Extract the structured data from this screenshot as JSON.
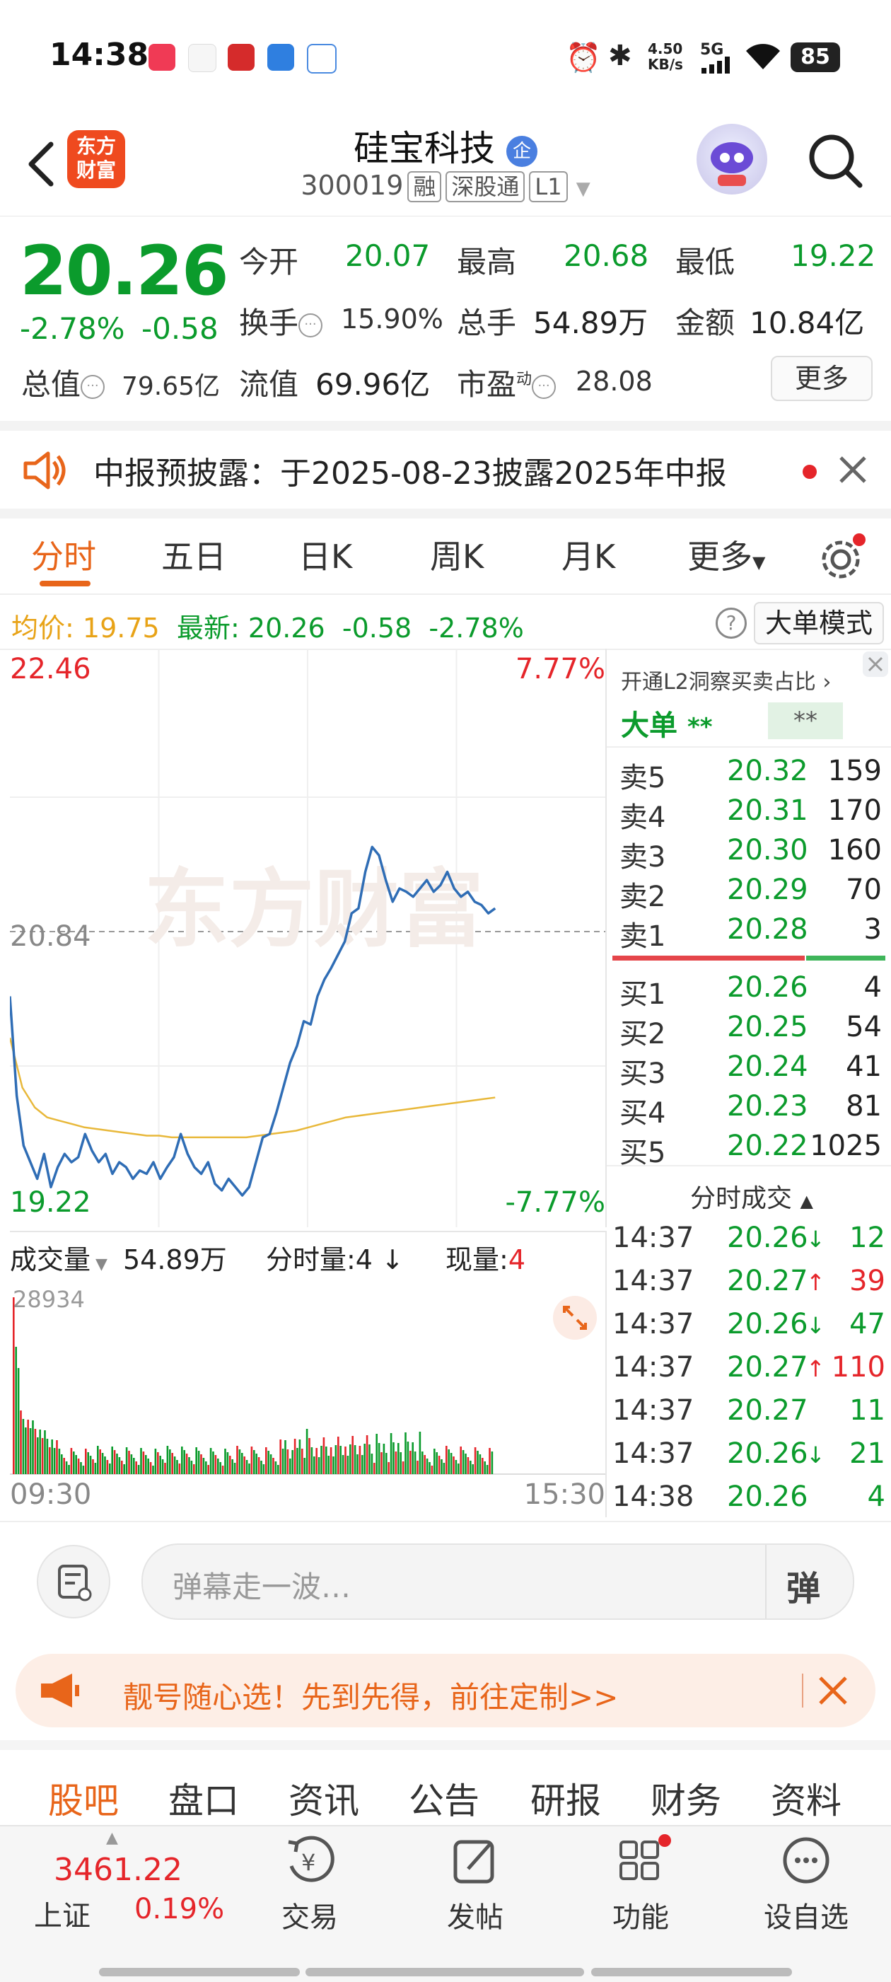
{
  "status_bar": {
    "time": "14:38",
    "net_speed_top": "4.50",
    "net_speed_bottom": "KB/s",
    "signal_label": "5G",
    "battery": "85"
  },
  "header": {
    "stock_name": "硅宝科技",
    "enterprise_badge": "企",
    "stock_code": "300019",
    "tags": [
      "融",
      "深股通",
      "L1"
    ]
  },
  "quote": {
    "price": "20.26",
    "change_pct": "-2.78%",
    "change": "-0.58",
    "open_label": "今开",
    "open": "20.07",
    "high_label": "最高",
    "high": "20.68",
    "low_label": "最低",
    "low": "19.22",
    "turnover_label": "换手",
    "turnover": "15.90%",
    "volume_label": "总手",
    "volume": "54.89万",
    "amount_label": "金额",
    "amount": "10.84亿",
    "mktcap_label": "总值",
    "mktcap": "79.65亿",
    "float_label": "流值",
    "float": "69.96亿",
    "pe_label": "市盈",
    "pe_sup": "动",
    "pe": "28.08",
    "more_label": "更多"
  },
  "notice": {
    "text": "中报预披露：于2025-08-23披露2025年中报"
  },
  "chart_tabs": [
    "分时",
    "五日",
    "日K",
    "周K",
    "月K",
    "更多"
  ],
  "info_line": {
    "avg_label": "均价:",
    "avg": "19.75",
    "latest_label": "最新:",
    "latest": "20.26",
    "change": "-0.58",
    "change_pct": "-2.78%",
    "help": "?",
    "mode_button": "大单模式"
  },
  "chart_labels": {
    "top_price": "22.46",
    "top_pct": "7.77%",
    "mid_price": "20.84",
    "bottom_price": "19.22",
    "bottom_pct": "-7.77%",
    "watermark": "东方财富"
  },
  "volume_labels": {
    "selector": "成交量",
    "total": "54.89万",
    "minute_vol": "分时量:4",
    "cur_label": "现量:",
    "cur": "4",
    "max": "28934",
    "start_time": "09:30",
    "end_time": "15:30"
  },
  "orderbook": {
    "l2_text": "开通L2洞察买卖占比",
    "big_order_label": "大单",
    "big_order_a": "**",
    "big_order_b": "**",
    "asks": [
      {
        "label": "卖5",
        "price": "20.32",
        "qty": "159"
      },
      {
        "label": "卖4",
        "price": "20.31",
        "qty": "170"
      },
      {
        "label": "卖3",
        "price": "20.30",
        "qty": "160"
      },
      {
        "label": "卖2",
        "price": "20.29",
        "qty": "70"
      },
      {
        "label": "卖1",
        "price": "20.28",
        "qty": "3"
      }
    ],
    "bids": [
      {
        "label": "买1",
        "price": "20.26",
        "qty": "4"
      },
      {
        "label": "买2",
        "price": "20.25",
        "qty": "54"
      },
      {
        "label": "买3",
        "price": "20.24",
        "qty": "41"
      },
      {
        "label": "买4",
        "price": "20.23",
        "qty": "81"
      },
      {
        "label": "买5",
        "price": "20.22",
        "qty": "1025"
      }
    ],
    "ticks_title": "分时成交",
    "ticks": [
      {
        "time": "14:37",
        "price": "20.26",
        "dir": "↓",
        "vol": "12"
      },
      {
        "time": "14:37",
        "price": "20.27",
        "dir": "↑",
        "vol": "39"
      },
      {
        "time": "14:37",
        "price": "20.26",
        "dir": "↓",
        "vol": "47"
      },
      {
        "time": "14:37",
        "price": "20.27",
        "dir": "↑",
        "vol": "110"
      },
      {
        "time": "14:37",
        "price": "20.27",
        "dir": "",
        "vol": "11"
      },
      {
        "time": "14:37",
        "price": "20.26",
        "dir": "↓",
        "vol": "21"
      },
      {
        "time": "14:38",
        "price": "20.26",
        "dir": "",
        "vol": "4"
      }
    ]
  },
  "danmu": {
    "placeholder": "弹幕走一波…",
    "send": "弹"
  },
  "promo": {
    "text": "靓号随心选！先到先得，前往定制>>"
  },
  "bottom_tabs": [
    "股吧",
    "盘口",
    "资讯",
    "公告",
    "研报",
    "财务",
    "资料"
  ],
  "nav": {
    "index_value": "3461.22",
    "index_name": "上证",
    "index_pct": "0.19%",
    "items": [
      "交易",
      "发帖",
      "功能",
      "设自选"
    ]
  },
  "chart_data": {
    "type": "line",
    "title": "",
    "xlabel": "",
    "ylabel": "",
    "x_range": [
      "09:30",
      "15:30"
    ],
    "ylim": [
      19.22,
      22.46
    ],
    "reference": 20.84,
    "series": [
      {
        "values": [
          20.45,
          19.85,
          19.55,
          19.45,
          19.35,
          19.5,
          19.3,
          19.42,
          19.5,
          19.45,
          19.48,
          19.62,
          19.52,
          19.45,
          19.5,
          19.38,
          19.45,
          19.42,
          19.35,
          19.4,
          19.38,
          19.45,
          19.35,
          19.42,
          19.48,
          19.62,
          19.5,
          19.42,
          19.38,
          19.45,
          19.32,
          19.28,
          19.35,
          19.3,
          19.25,
          19.3,
          19.45,
          19.6,
          19.62,
          19.75,
          19.9,
          20.05,
          20.15,
          20.3,
          20.28,
          20.45,
          20.55,
          20.62,
          20.7,
          20.78,
          20.95,
          20.98,
          21.2,
          21.35,
          21.3,
          21.15,
          21.02,
          21.1,
          21.08,
          21.05,
          21.1,
          21.15,
          21.08,
          21.12,
          21.2,
          21.1,
          21.05,
          21.08,
          21.02,
          21.0,
          20.95,
          20.98
        ]
      },
      {
        "values": [
          20.2,
          19.9,
          19.78,
          19.72,
          19.7,
          19.68,
          19.66,
          19.65,
          19.64,
          19.63,
          19.62,
          19.61,
          19.61,
          19.6,
          19.6,
          19.6,
          19.6,
          19.6,
          19.6,
          19.6,
          19.61,
          19.62,
          19.63,
          19.64,
          19.66,
          19.68,
          19.7,
          19.72,
          19.73,
          19.74,
          19.75,
          19.76,
          19.77,
          19.78,
          19.79,
          19.8,
          19.81,
          19.82,
          19.83,
          19.84
        ]
      }
    ],
    "volume_max": 28934
  }
}
